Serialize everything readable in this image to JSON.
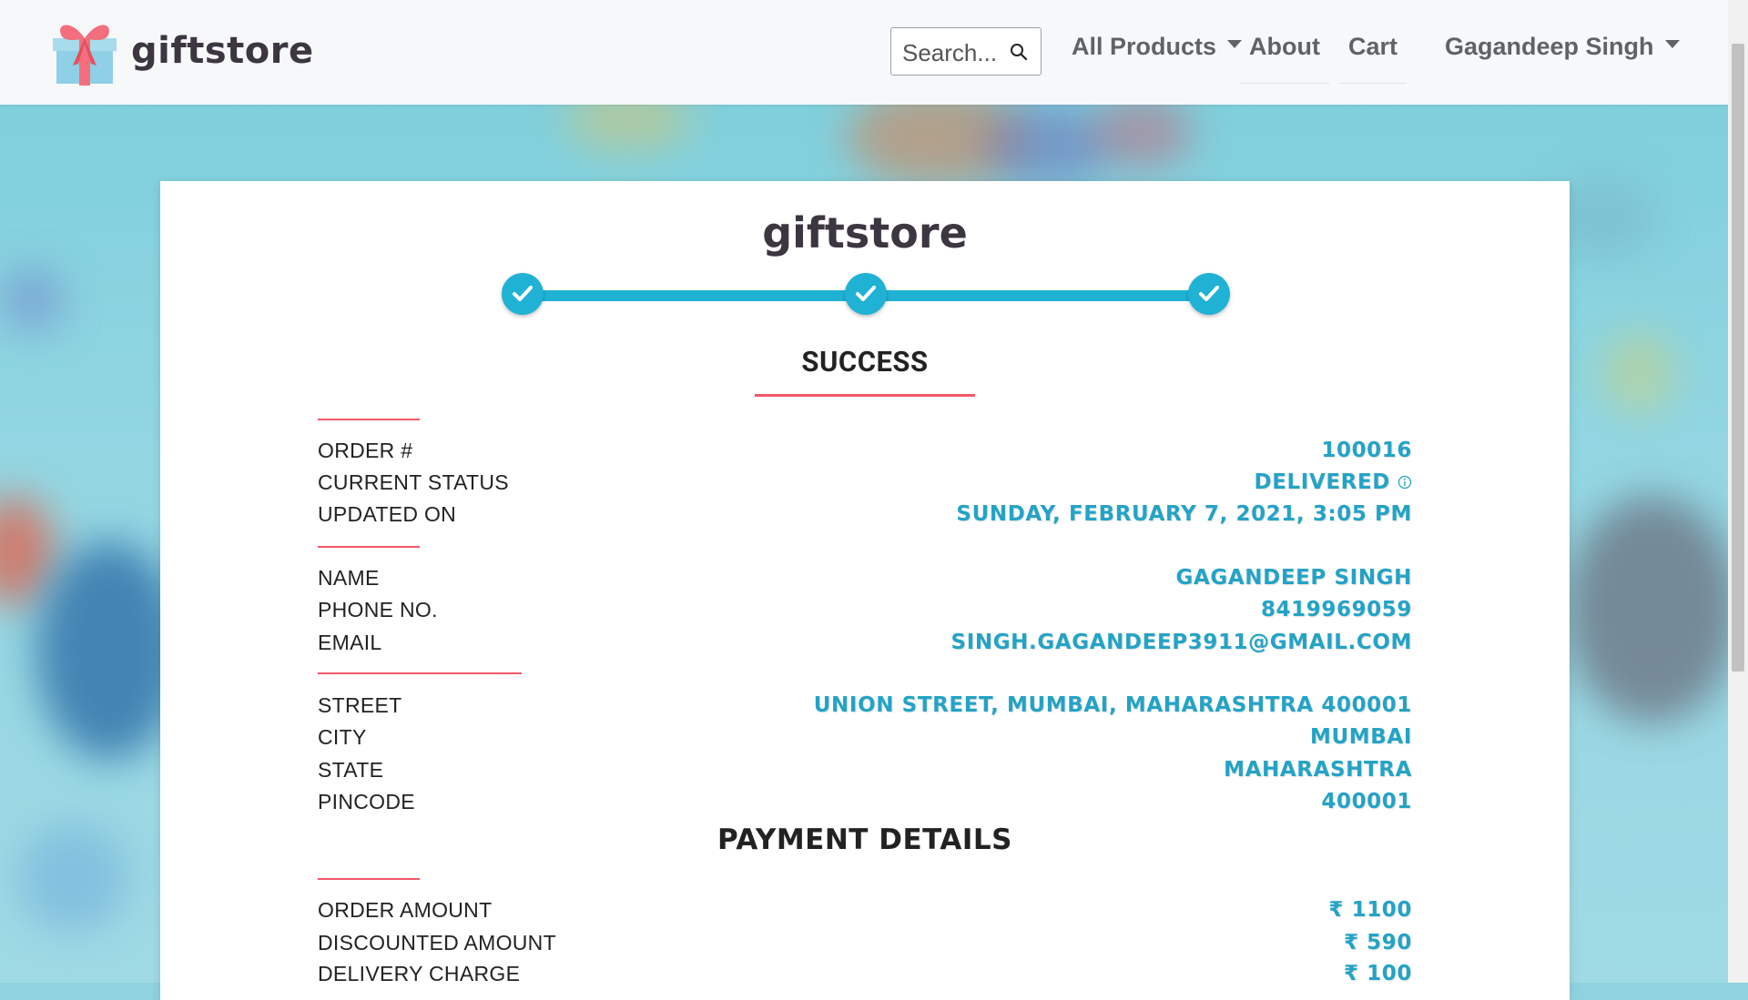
{
  "navbar": {
    "brand": "giftstore",
    "search_placeholder": "Search...",
    "items": [
      {
        "label": "All Products",
        "dropdown": true
      },
      {
        "label": "About"
      },
      {
        "label": "Cart"
      },
      {
        "label": "Gagandeep Singh",
        "dropdown": true
      }
    ]
  },
  "card": {
    "title": "giftstore",
    "progress_steps_completed": 3,
    "progress_steps_total": 3,
    "status_heading": "SUCCESS",
    "order_section": [
      {
        "label": "ORDER #",
        "value": "100016"
      },
      {
        "label": "CURRENT STATUS",
        "value": "DELIVERED"
      },
      {
        "label": "UPDATED ON",
        "value": "SUNDAY, FEBRUARY 7, 2021, 3:05 PM"
      }
    ],
    "contact_section": [
      {
        "label": "NAME",
        "value": "GAGANDEEP SINGH"
      },
      {
        "label": "PHONE NO.",
        "value": "8419969059"
      },
      {
        "label": "EMAIL",
        "value": "SINGH.GAGANDEEP3911@GMAIL.COM"
      }
    ],
    "address_section": [
      {
        "label": "STREET",
        "value": "UNION STREET, MUMBAI, MAHARASHTRA 400001"
      },
      {
        "label": "CITY",
        "value": "MUMBAI"
      },
      {
        "label": "STATE",
        "value": "MAHARASHTRA"
      },
      {
        "label": "PINCODE",
        "value": "400001"
      }
    ],
    "payment_heading": "PAYMENT DETAILS",
    "payment_section": [
      {
        "label": "ORDER AMOUNT",
        "value": "₹ 1100"
      },
      {
        "label": "DISCOUNTED AMOUNT",
        "value": "₹ 590"
      },
      {
        "label": "DELIVERY CHARGE",
        "value": "₹ 100"
      }
    ]
  },
  "colors": {
    "accent": "#1fb2d5",
    "value_text": "#24a3c6",
    "divider": "#f05869",
    "brand_text": "#3b3640"
  },
  "icons": [
    "gift-logo-icon",
    "search-icon",
    "check-icon",
    "info-icon",
    "caret-down-icon"
  ]
}
